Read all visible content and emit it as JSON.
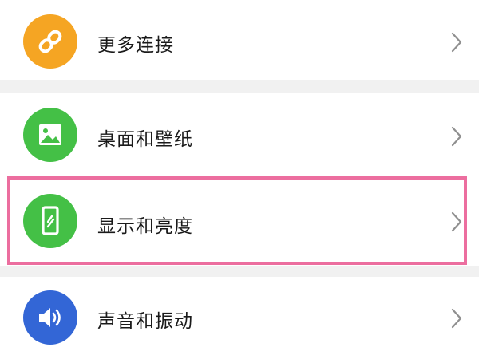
{
  "settings_list": {
    "items": [
      {
        "id": "more-connections",
        "label": "更多连接",
        "icon": "link-icon",
        "color": "#f5a523"
      },
      {
        "id": "desktop-wallpaper",
        "label": "桌面和壁纸",
        "icon": "image-icon",
        "color": "#44c046"
      },
      {
        "id": "display-brightness",
        "label": "显示和亮度",
        "icon": "phone-display-icon",
        "color": "#44c046",
        "highlighted": true
      },
      {
        "id": "sound-vibration",
        "label": "声音和振动",
        "icon": "speaker-icon",
        "color": "#3366d6"
      }
    ]
  },
  "highlight_color": "#ec6e9f",
  "separator_color": "#f1f1f1",
  "chevron_icon": "chevron-right-icon"
}
